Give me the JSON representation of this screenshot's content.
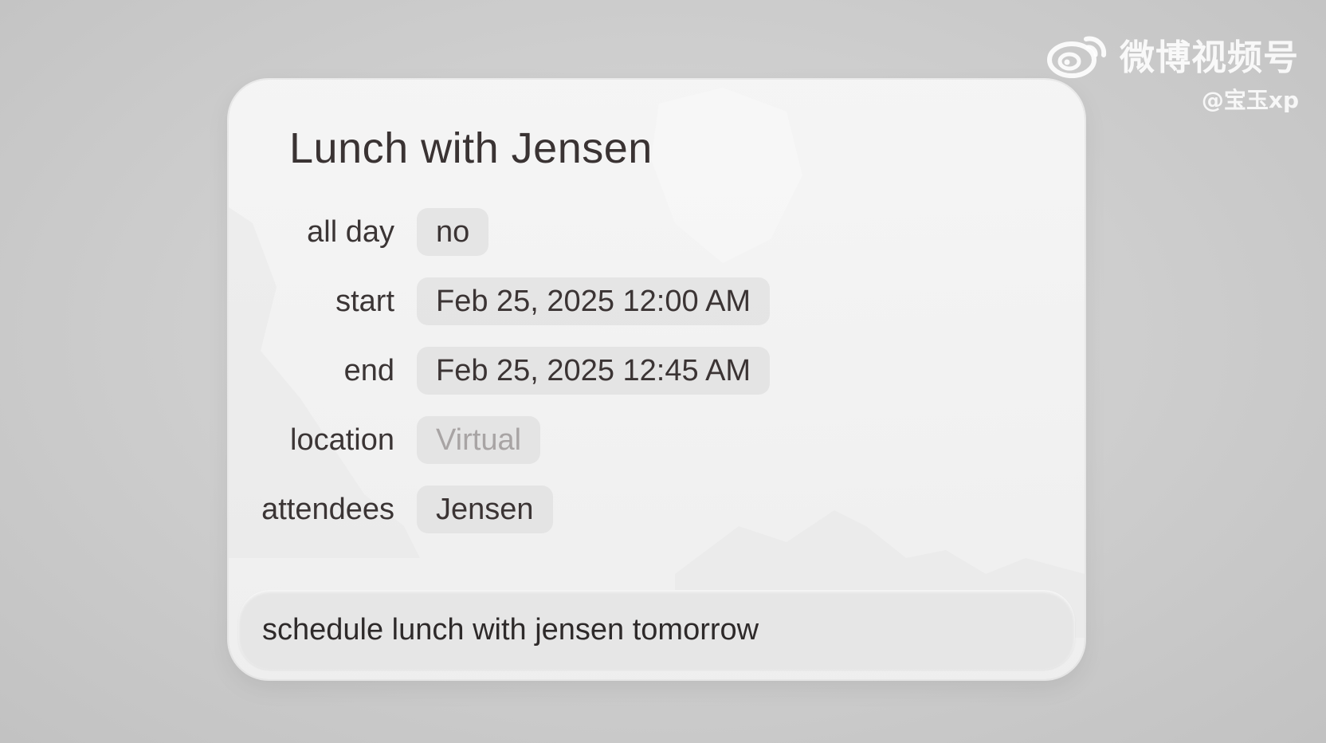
{
  "watermark": {
    "brand": "微博视频号",
    "handle": "@宝玉xp",
    "logo_icon": "weibo-icon"
  },
  "event": {
    "title": "Lunch with Jensen",
    "fields": {
      "all_day": {
        "label": "all day",
        "value": "no"
      },
      "start": {
        "label": "start",
        "value": "Feb 25, 2025 12:00 AM"
      },
      "end": {
        "label": "end",
        "value": "Feb 25, 2025 12:45 AM"
      },
      "location": {
        "label": "location",
        "placeholder": "Virtual"
      },
      "attendees": {
        "label": "attendees",
        "value": "Jensen"
      }
    }
  },
  "prompt": {
    "value": "schedule lunch with jensen tomorrow"
  },
  "colors": {
    "background": "#cfcfcf",
    "card": "#f3f3f3",
    "pill": "#e2e2e2",
    "text": "#3a3434",
    "placeholder": "#a8a4a4"
  }
}
